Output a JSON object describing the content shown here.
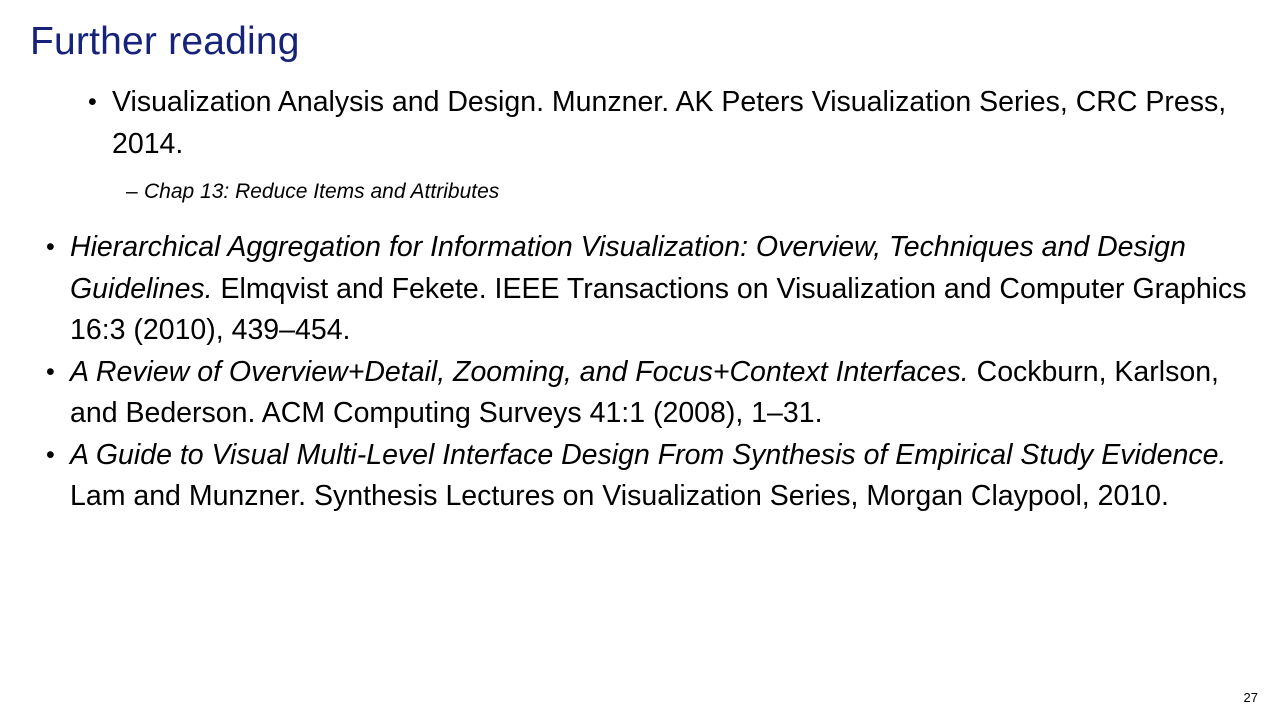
{
  "slide": {
    "title": "Further reading",
    "title_color": "#17227a",
    "page_number": "27",
    "bullet_marker": "•",
    "dash_marker": "–",
    "items": [
      {
        "level": 1,
        "indented": true,
        "title": "Visualization Analysis and Design.",
        "rest": " Munzner.  AK Peters Visualization Series, CRC Press, 2014.",
        "title_italic": false
      },
      {
        "level": 2,
        "text": "Chap 13: Reduce Items and Attributes"
      },
      {
        "level": 1,
        "indented": false,
        "title": "Hierarchical Aggregation for Information Visualization: Overview, Techniques and Design Guidelines.",
        "rest": " Elmqvist and Fekete. IEEE Transactions on Visualization and Computer Graphics 16:3 (2010), 439–454.",
        "title_italic": true
      },
      {
        "level": 1,
        "indented": false,
        "title": "A Review of Overview+Detail, Zooming, and Focus+Context Interfaces.",
        "rest": " Cockburn, Karlson, and Bederson.  ACM Computing Surveys 41:1 (2008), 1–31.",
        "title_italic": true
      },
      {
        "level": 1,
        "indented": false,
        "title": "A Guide to Visual Multi-Level Interface Design From Synthesis of Empirical Study Evidence.",
        "rest": " Lam and Munzner. Synthesis Lectures on Visualization Series, Morgan Claypool, 2010.",
        "title_italic": true
      }
    ]
  }
}
